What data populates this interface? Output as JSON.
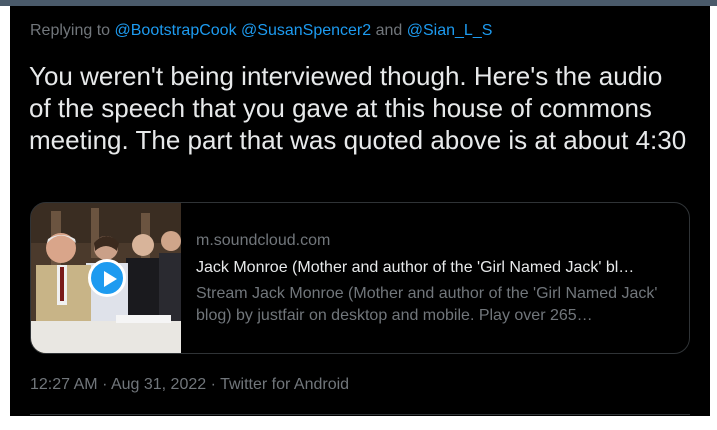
{
  "reply": {
    "prefix": "Replying to",
    "mentions": [
      "@BootstrapCook",
      "@SusanSpencer2",
      "@Sian_L_S"
    ],
    "conjunction": "and"
  },
  "tweet": {
    "text": "You weren't being interviewed though. Here's the audio of the speech that you gave at this house of commons meeting. The part that was quoted above is at about 4:30"
  },
  "card": {
    "domain": "m.soundcloud.com",
    "title": "Jack Monroe (Mother and author of the 'Girl Named Jack' bl…",
    "description": "Stream Jack Monroe (Mother and author of the 'Girl Named Jack' blog) by justfair on desktop and mobile. Play over 265…",
    "play_icon": "play-icon"
  },
  "meta": {
    "time": "12:27 AM",
    "date": "Aug 31, 2022",
    "source": "Twitter for Android",
    "separator": "·"
  },
  "colors": {
    "background": "#000000",
    "text": "#e7e9ea",
    "muted": "#71767b",
    "link": "#1d9bf0",
    "border": "#2f3336"
  }
}
